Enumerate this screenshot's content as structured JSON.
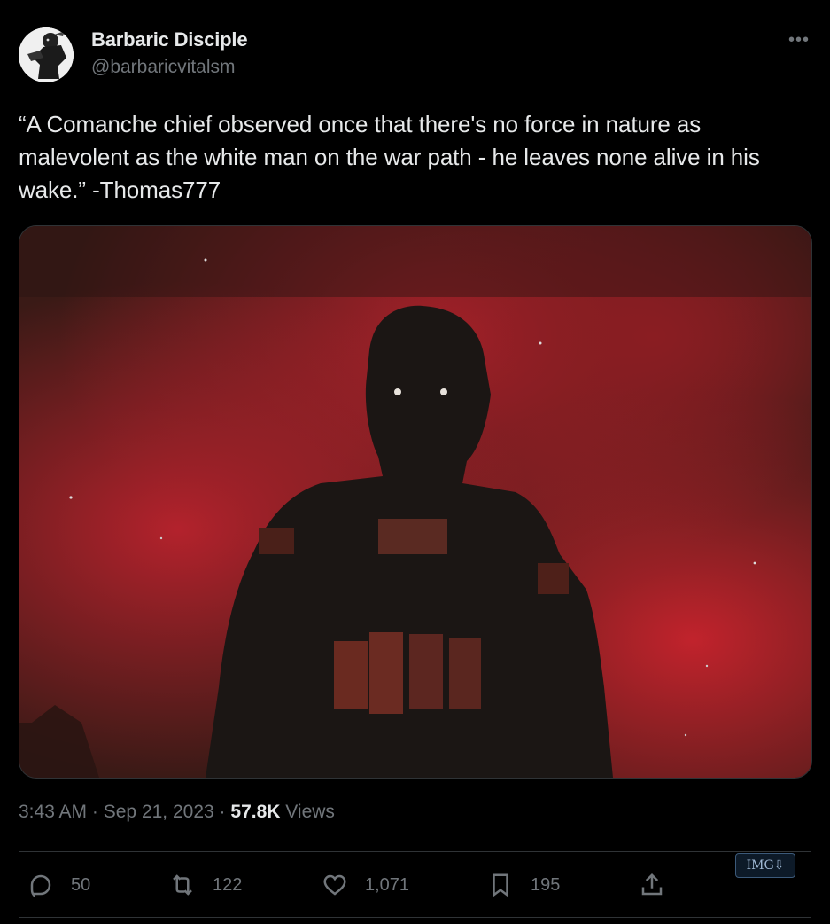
{
  "author": {
    "display_name": "Barbaric Disciple",
    "handle": "@barbaricvitalsm"
  },
  "tweet": {
    "text": "“A Comanche chief observed once that there's no force in nature as malevolent as the white man on the war path - he leaves none alive in his wake.” -Thomas777"
  },
  "meta": {
    "time": "3:43 AM",
    "separator": "·",
    "date": "Sep 21, 2023",
    "views_count": "57.8K",
    "views_label": "Views"
  },
  "actions": {
    "replies": "50",
    "reposts": "122",
    "likes": "1,071",
    "bookmarks": "195"
  },
  "badge": {
    "label": "IMG⇩"
  },
  "icons": {
    "more": "more-icon",
    "reply": "reply-icon",
    "repost": "repost-icon",
    "like": "heart-icon",
    "bookmark": "bookmark-icon",
    "share": "share-icon"
  },
  "colors": {
    "background": "#000000",
    "text": "#e7e9ea",
    "secondary": "#71767b",
    "divider": "#2f3336"
  }
}
